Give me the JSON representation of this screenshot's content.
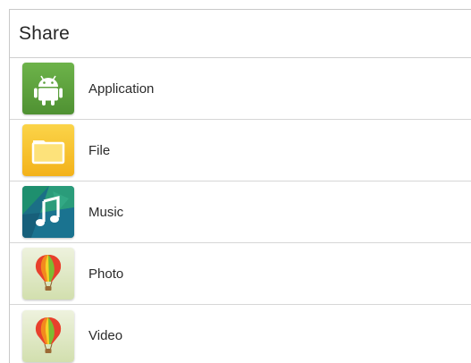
{
  "dialog": {
    "title": "Share",
    "items": [
      {
        "label": "Application",
        "icon": "android-icon",
        "color": "#5a9f3b"
      },
      {
        "label": "File",
        "icon": "folder-icon",
        "color": "#f6c22c"
      },
      {
        "label": "Music",
        "icon": "music-note-icon",
        "color": "#1f8a6a"
      },
      {
        "label": "Photo",
        "icon": "hot-air-balloon-icon",
        "color": "#dfe8c8"
      },
      {
        "label": "Video",
        "icon": "hot-air-balloon-icon",
        "color": "#dfe8c8"
      }
    ]
  }
}
